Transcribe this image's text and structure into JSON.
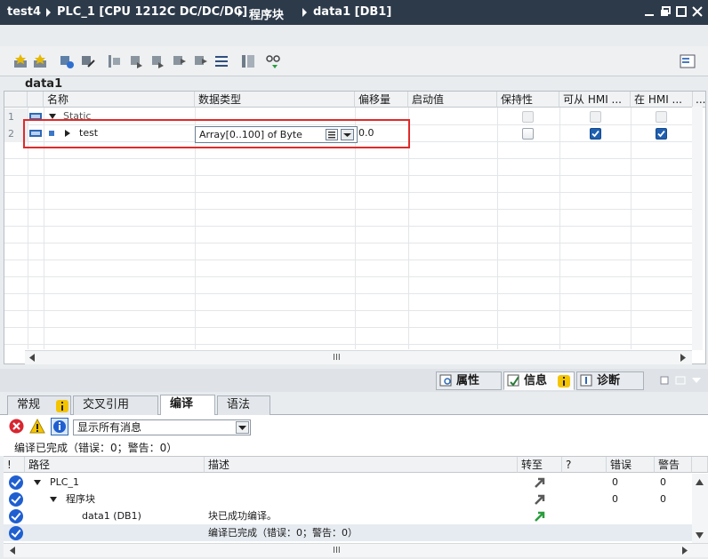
{
  "titlebar": {
    "project": "test4",
    "device": "PLC_1 [CPU 1212C DC/DC/DC]",
    "folder": "程序块",
    "block": "data1 [DB1]"
  },
  "editor": {
    "block_name": "data1",
    "columns": [
      "名称",
      "数据类型",
      "偏移量",
      "启动值",
      "保持性",
      "可从 HMI ...",
      "在 HMI ..."
    ],
    "rows": [
      {
        "num": "1",
        "name": "Static",
        "datatype": "",
        "offset": "",
        "start": "",
        "retain": false,
        "hmi_access": false,
        "hmi_visible": false
      },
      {
        "num": "2",
        "name": "test",
        "datatype": "Array[0..100] of Byte",
        "offset": "0.0",
        "start": "",
        "retain": false,
        "hmi_access": true,
        "hmi_visible": true
      }
    ],
    "hscroll_mark": "III"
  },
  "inspector": {
    "tabs": [
      {
        "label": "属性",
        "active": false
      },
      {
        "label": "信息",
        "active": true
      },
      {
        "label": "诊断",
        "active": false
      }
    ],
    "subtabs": [
      {
        "label": "常规",
        "active": false
      },
      {
        "label": "交叉引用",
        "active": false
      },
      {
        "label": "编译",
        "active": true
      },
      {
        "label": "语法",
        "active": false
      }
    ],
    "filter_value": "显示所有消息",
    "status_text": "编译已完成（错误：0；警告：0）",
    "msg_columns": [
      "!",
      "路径",
      "描述",
      "转至",
      "?",
      "错误",
      "警告"
    ],
    "messages": [
      {
        "path": "PLC_1",
        "desc": "",
        "errors": "0",
        "warnings": "0",
        "indent": 1
      },
      {
        "path": "程序块",
        "desc": "",
        "errors": "0",
        "warnings": "0",
        "indent": 2
      },
      {
        "path": "data1 (DB1)",
        "desc": "块已成功编译。",
        "errors": "",
        "warnings": "",
        "indent": 3
      },
      {
        "path": "",
        "desc": "编译已完成（错误：0；警告：0）",
        "errors": "",
        "warnings": "",
        "indent": 0
      }
    ],
    "hscroll_mark": "III"
  },
  "colors": {
    "titlebar": "#2d3a4a",
    "highlight": "#e02a2a",
    "ok_blue": "#1f5fd0",
    "check_blue": "#1f5fb0"
  }
}
